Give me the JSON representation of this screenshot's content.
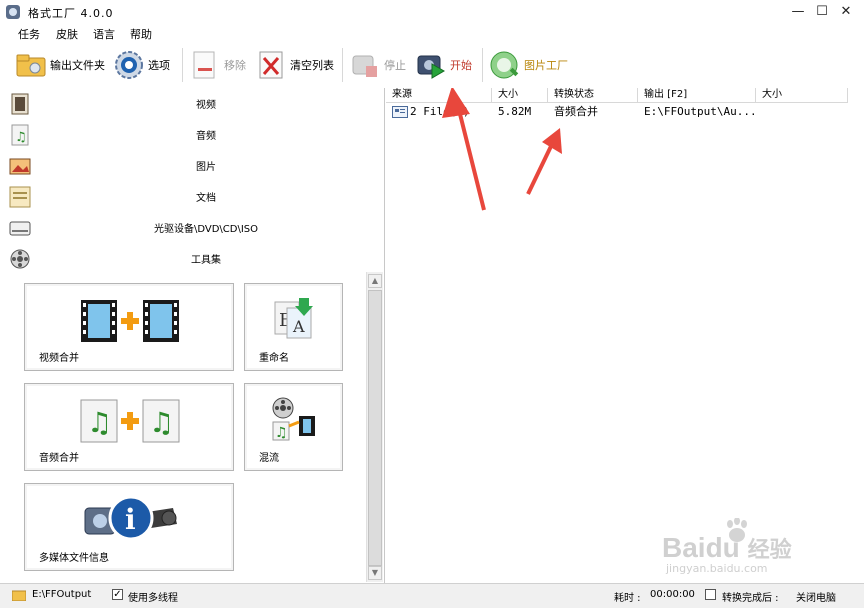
{
  "window": {
    "title": "格式工厂 4.0.0",
    "minimize": "—",
    "maximize": "☐",
    "close": "✕"
  },
  "menu": [
    "任务",
    "皮肤",
    "语言",
    "帮助"
  ],
  "toolbar": {
    "output_folder": "输出文件夹",
    "options": "选项",
    "remove": "移除",
    "clear_list": "清空列表",
    "stop": "停止",
    "start": "开始",
    "picture_factory": "图片工厂"
  },
  "categories": [
    {
      "label": "视频",
      "icon": "video-icon"
    },
    {
      "label": "音频",
      "icon": "audio-icon"
    },
    {
      "label": "图片",
      "icon": "picture-icon"
    },
    {
      "label": "文档",
      "icon": "document-icon"
    },
    {
      "label": "光驱设备\\DVD\\CD\\ISO",
      "icon": "disc-drive-icon"
    },
    {
      "label": "工具集",
      "icon": "tools-icon"
    }
  ],
  "tools": [
    {
      "label": "视频合并",
      "icon": "video-merge-icon"
    },
    {
      "label": "重命名",
      "icon": "rename-icon"
    },
    {
      "label": "音频合并",
      "icon": "audio-merge-icon"
    },
    {
      "label": "混流",
      "icon": "mux-icon"
    },
    {
      "label": "多媒体文件信息",
      "icon": "media-info-icon"
    }
  ],
  "table": {
    "headers": [
      "来源",
      "大小",
      "转换状态",
      "输出 [F2]",
      "大小"
    ],
    "rows": [
      {
        "source": "2 File(s)",
        "size": "5.82M",
        "status": "音频合并",
        "output": "E:\\FFOutput\\Au...",
        "out_size": ""
      }
    ]
  },
  "status": {
    "output_path": "E:\\FFOutput",
    "multithread_label": "使用多线程",
    "multithread_checked": true,
    "elapsed_label": "耗时 :",
    "elapsed": "00:00:00",
    "after_done_label": "转换完成后 :",
    "after_done_value": "关闭电脑",
    "after_done_checked": false
  },
  "watermark": {
    "brand": "Bai",
    "brand2": "du",
    "brand_cn": "经验",
    "url": "jingyan.baidu.com"
  },
  "colors": {
    "accent_green": "#27a33a",
    "arrow_red": "#e8473c",
    "start_label": "#c0392b",
    "picture_label": "#b8860b"
  }
}
